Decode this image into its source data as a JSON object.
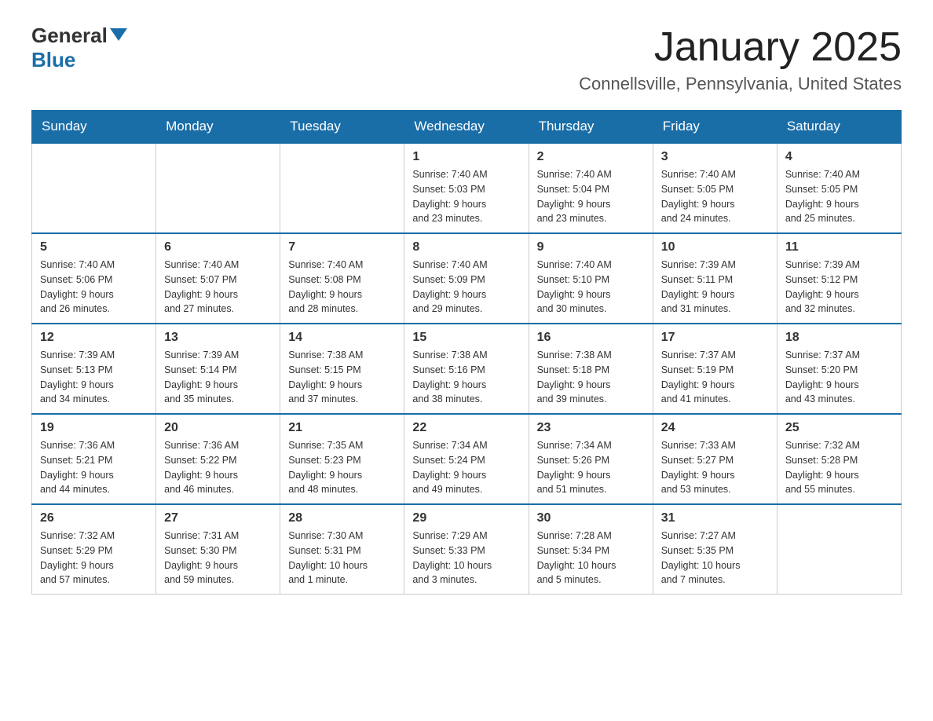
{
  "header": {
    "logo_general": "General",
    "logo_blue": "Blue",
    "title": "January 2025",
    "subtitle": "Connellsville, Pennsylvania, United States"
  },
  "days_of_week": [
    "Sunday",
    "Monday",
    "Tuesday",
    "Wednesday",
    "Thursday",
    "Friday",
    "Saturday"
  ],
  "weeks": [
    [
      {
        "day": "",
        "info": ""
      },
      {
        "day": "",
        "info": ""
      },
      {
        "day": "",
        "info": ""
      },
      {
        "day": "1",
        "info": "Sunrise: 7:40 AM\nSunset: 5:03 PM\nDaylight: 9 hours\nand 23 minutes."
      },
      {
        "day": "2",
        "info": "Sunrise: 7:40 AM\nSunset: 5:04 PM\nDaylight: 9 hours\nand 23 minutes."
      },
      {
        "day": "3",
        "info": "Sunrise: 7:40 AM\nSunset: 5:05 PM\nDaylight: 9 hours\nand 24 minutes."
      },
      {
        "day": "4",
        "info": "Sunrise: 7:40 AM\nSunset: 5:05 PM\nDaylight: 9 hours\nand 25 minutes."
      }
    ],
    [
      {
        "day": "5",
        "info": "Sunrise: 7:40 AM\nSunset: 5:06 PM\nDaylight: 9 hours\nand 26 minutes."
      },
      {
        "day": "6",
        "info": "Sunrise: 7:40 AM\nSunset: 5:07 PM\nDaylight: 9 hours\nand 27 minutes."
      },
      {
        "day": "7",
        "info": "Sunrise: 7:40 AM\nSunset: 5:08 PM\nDaylight: 9 hours\nand 28 minutes."
      },
      {
        "day": "8",
        "info": "Sunrise: 7:40 AM\nSunset: 5:09 PM\nDaylight: 9 hours\nand 29 minutes."
      },
      {
        "day": "9",
        "info": "Sunrise: 7:40 AM\nSunset: 5:10 PM\nDaylight: 9 hours\nand 30 minutes."
      },
      {
        "day": "10",
        "info": "Sunrise: 7:39 AM\nSunset: 5:11 PM\nDaylight: 9 hours\nand 31 minutes."
      },
      {
        "day": "11",
        "info": "Sunrise: 7:39 AM\nSunset: 5:12 PM\nDaylight: 9 hours\nand 32 minutes."
      }
    ],
    [
      {
        "day": "12",
        "info": "Sunrise: 7:39 AM\nSunset: 5:13 PM\nDaylight: 9 hours\nand 34 minutes."
      },
      {
        "day": "13",
        "info": "Sunrise: 7:39 AM\nSunset: 5:14 PM\nDaylight: 9 hours\nand 35 minutes."
      },
      {
        "day": "14",
        "info": "Sunrise: 7:38 AM\nSunset: 5:15 PM\nDaylight: 9 hours\nand 37 minutes."
      },
      {
        "day": "15",
        "info": "Sunrise: 7:38 AM\nSunset: 5:16 PM\nDaylight: 9 hours\nand 38 minutes."
      },
      {
        "day": "16",
        "info": "Sunrise: 7:38 AM\nSunset: 5:18 PM\nDaylight: 9 hours\nand 39 minutes."
      },
      {
        "day": "17",
        "info": "Sunrise: 7:37 AM\nSunset: 5:19 PM\nDaylight: 9 hours\nand 41 minutes."
      },
      {
        "day": "18",
        "info": "Sunrise: 7:37 AM\nSunset: 5:20 PM\nDaylight: 9 hours\nand 43 minutes."
      }
    ],
    [
      {
        "day": "19",
        "info": "Sunrise: 7:36 AM\nSunset: 5:21 PM\nDaylight: 9 hours\nand 44 minutes."
      },
      {
        "day": "20",
        "info": "Sunrise: 7:36 AM\nSunset: 5:22 PM\nDaylight: 9 hours\nand 46 minutes."
      },
      {
        "day": "21",
        "info": "Sunrise: 7:35 AM\nSunset: 5:23 PM\nDaylight: 9 hours\nand 48 minutes."
      },
      {
        "day": "22",
        "info": "Sunrise: 7:34 AM\nSunset: 5:24 PM\nDaylight: 9 hours\nand 49 minutes."
      },
      {
        "day": "23",
        "info": "Sunrise: 7:34 AM\nSunset: 5:26 PM\nDaylight: 9 hours\nand 51 minutes."
      },
      {
        "day": "24",
        "info": "Sunrise: 7:33 AM\nSunset: 5:27 PM\nDaylight: 9 hours\nand 53 minutes."
      },
      {
        "day": "25",
        "info": "Sunrise: 7:32 AM\nSunset: 5:28 PM\nDaylight: 9 hours\nand 55 minutes."
      }
    ],
    [
      {
        "day": "26",
        "info": "Sunrise: 7:32 AM\nSunset: 5:29 PM\nDaylight: 9 hours\nand 57 minutes."
      },
      {
        "day": "27",
        "info": "Sunrise: 7:31 AM\nSunset: 5:30 PM\nDaylight: 9 hours\nand 59 minutes."
      },
      {
        "day": "28",
        "info": "Sunrise: 7:30 AM\nSunset: 5:31 PM\nDaylight: 10 hours\nand 1 minute."
      },
      {
        "day": "29",
        "info": "Sunrise: 7:29 AM\nSunset: 5:33 PM\nDaylight: 10 hours\nand 3 minutes."
      },
      {
        "day": "30",
        "info": "Sunrise: 7:28 AM\nSunset: 5:34 PM\nDaylight: 10 hours\nand 5 minutes."
      },
      {
        "day": "31",
        "info": "Sunrise: 7:27 AM\nSunset: 5:35 PM\nDaylight: 10 hours\nand 7 minutes."
      },
      {
        "day": "",
        "info": ""
      }
    ]
  ]
}
